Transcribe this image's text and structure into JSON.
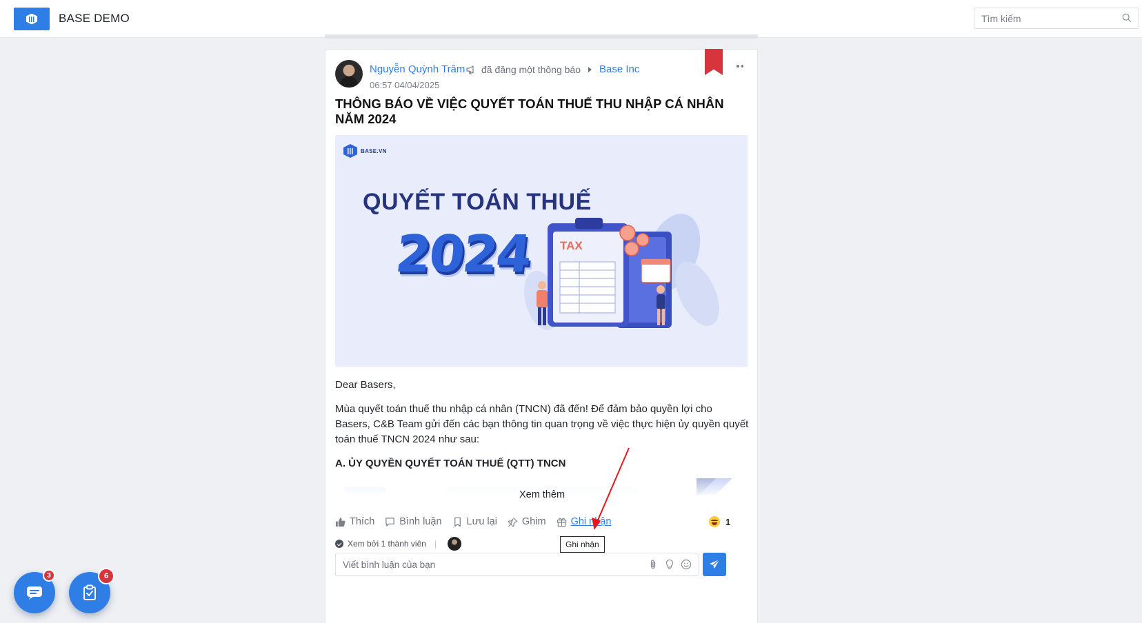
{
  "app": {
    "title": "BASE DEMO"
  },
  "search": {
    "placeholder": "Tìm kiếm"
  },
  "post": {
    "author": "Nguyễn Quỳnh Trâm",
    "action": "đã đăng một thông báo",
    "group": "Base Inc",
    "timestamp": "06:57 04/04/2025",
    "title": "THÔNG BÁO VỀ VIỆC QUYẾT TOÁN THUẾ THU NHẬP CÁ NHÂN NĂM 2024",
    "banner": {
      "brand": "BASE.VN",
      "heading": "QUYẾT TOÁN THUẾ",
      "year": "2024",
      "tax_label": "TAX"
    },
    "greeting": "Dear Basers,",
    "body": "Mùa quyết toán thuế thu nhập cá nhân (TNCN) đã đến! Để đảm bảo quyền lợi cho Basers, C&B Team gửi đến các bạn thông tin quan trọng về việc thực hiện ủy quyền quyết toán thuế TNCN 2024 như sau:",
    "section_heading": "A. ỦY QUYỀN QUYẾT TOÁN THUẾ (QTT) TNCN",
    "see_more": "Xem thêm"
  },
  "actions": {
    "like": "Thích",
    "comment": "Bình luận",
    "save": "Lưu lại",
    "pin": "Ghim",
    "acknowledge": "Ghi nhận"
  },
  "reactions": {
    "icon": "laughing-emoji-icon",
    "count": "1"
  },
  "seen": {
    "text": "Xem bởi 1 thành viên",
    "separator": "|"
  },
  "tooltip": {
    "text": "Ghi nhận"
  },
  "comment": {
    "placeholder": "Viết bình luận của bạn"
  },
  "fabs": {
    "chat_badge": "3",
    "tasks_badge": "6"
  },
  "colors": {
    "accent": "#2f7ee6",
    "bookmark": "#d8343d",
    "badge": "#d8343d",
    "annotation_arrow": "#e8151b"
  }
}
